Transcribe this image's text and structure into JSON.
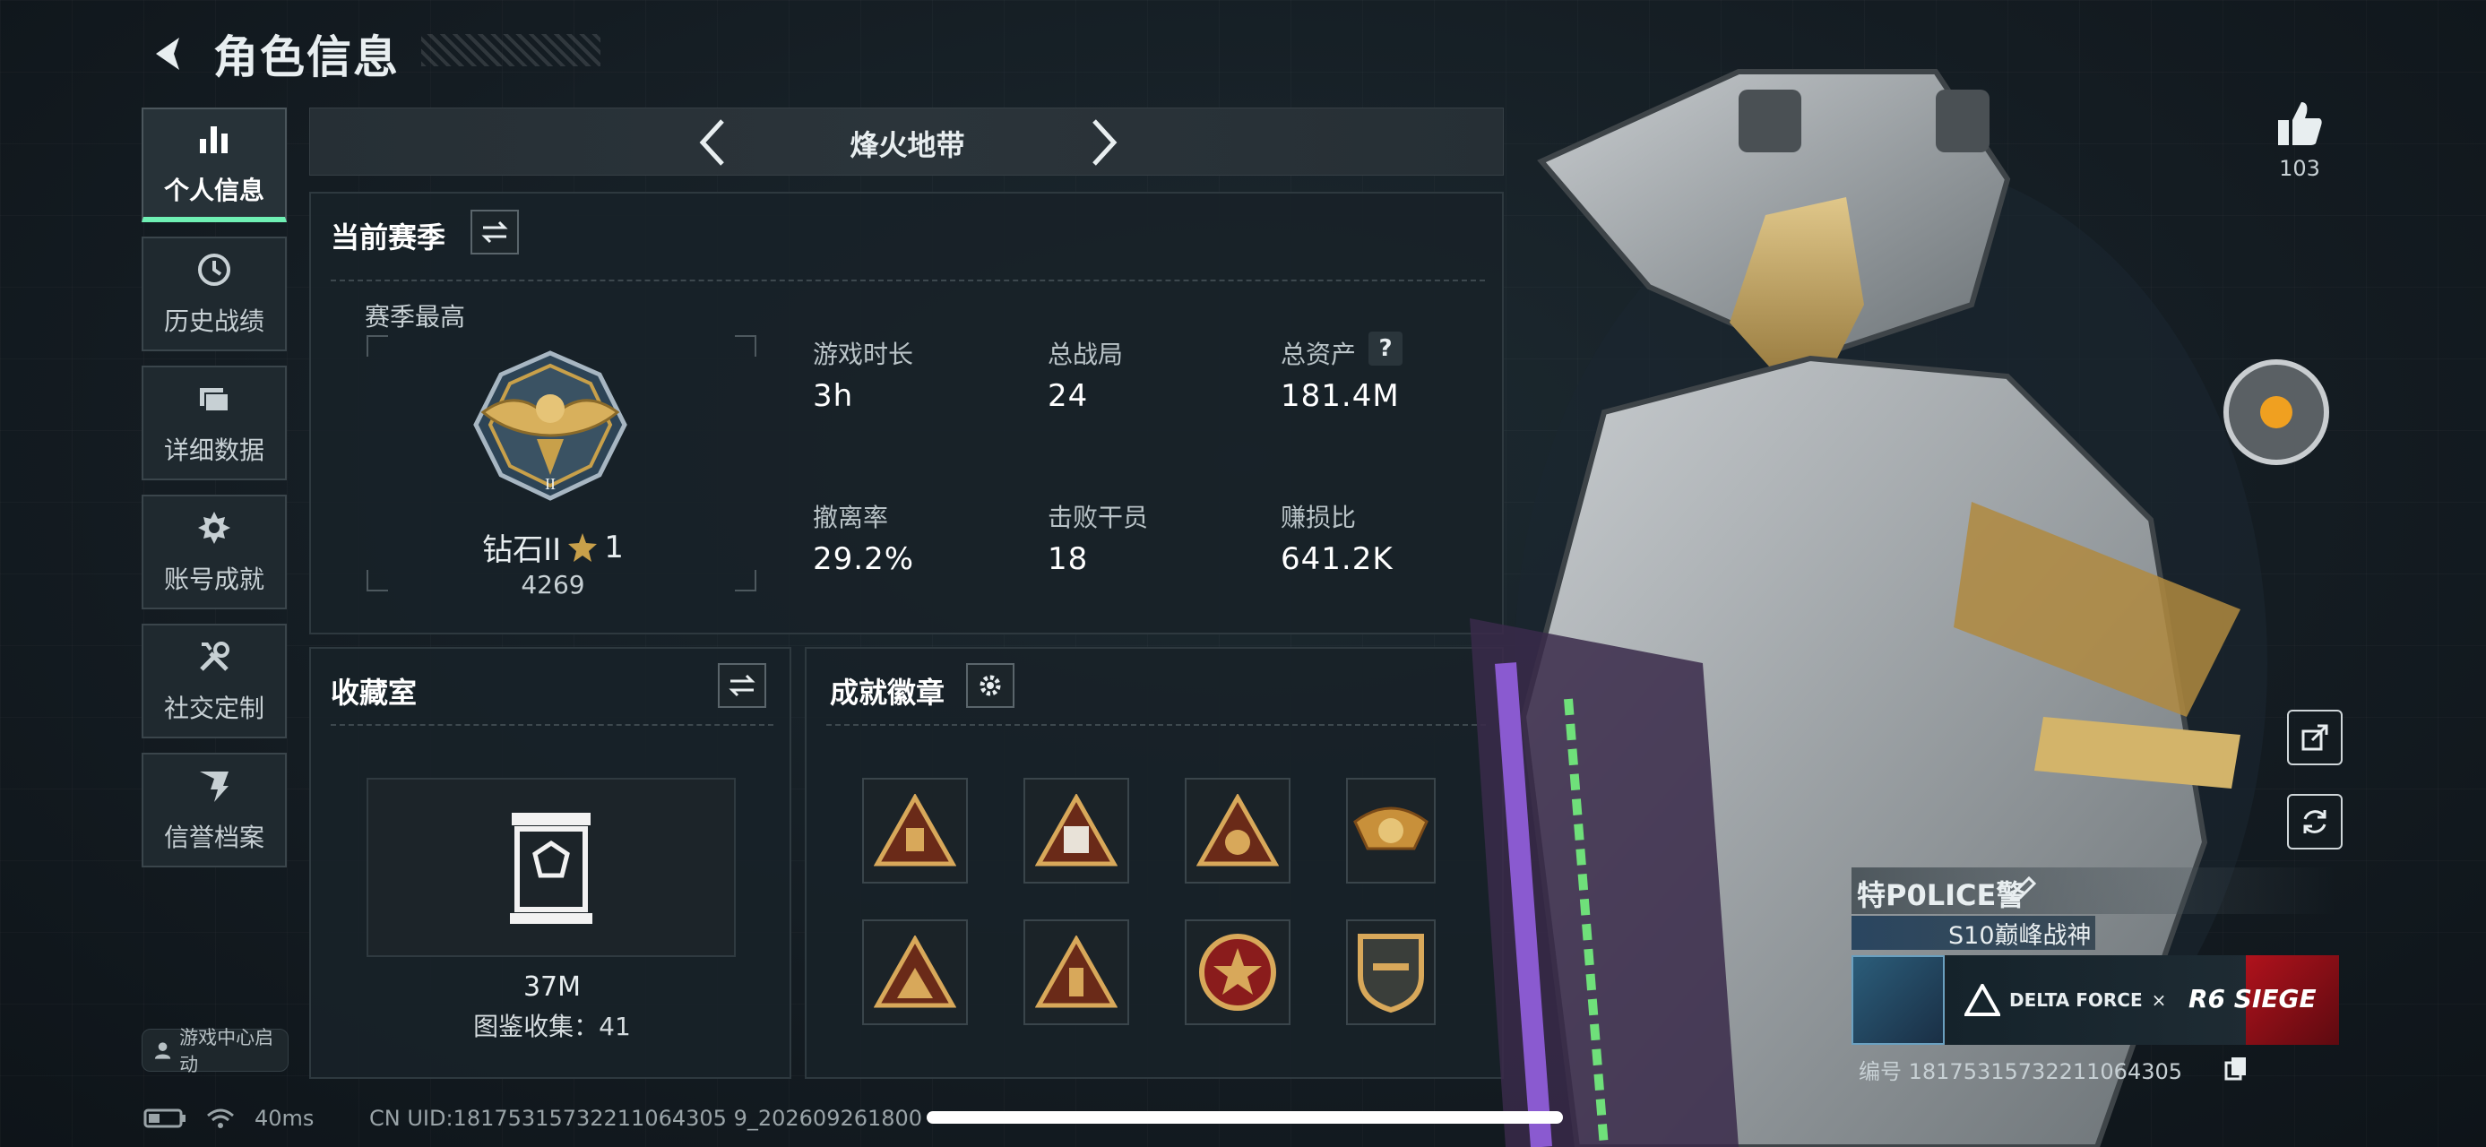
{
  "header": {
    "title": "角色信息"
  },
  "sidebar": {
    "items": [
      {
        "label": "个人信息",
        "icon": "bar-chart-icon"
      },
      {
        "label": "历史战绩",
        "icon": "clock-icon"
      },
      {
        "label": "详细数据",
        "icon": "folder-icon"
      },
      {
        "label": "账号成就",
        "icon": "achievement-icon"
      },
      {
        "label": "社交定制",
        "icon": "tools-icon"
      },
      {
        "label": "信誉档案",
        "icon": "shield-icon"
      }
    ],
    "launch_label": "游戏中心启动"
  },
  "mode": {
    "name": "烽火地带"
  },
  "season": {
    "title": "当前赛季",
    "best_label": "赛季最高",
    "rank_name": "钻石II",
    "rank_stars": "1",
    "rank_score": "4269",
    "stats": [
      {
        "label": "游戏时长",
        "value": "3h"
      },
      {
        "label": "总战局",
        "value": "24"
      },
      {
        "label": "总资产",
        "value": "181.4M"
      },
      {
        "label": "撤离率",
        "value": "29.2%"
      },
      {
        "label": "击败干员",
        "value": "18"
      },
      {
        "label": "赚损比",
        "value": "641.2K"
      }
    ]
  },
  "collection": {
    "title": "收藏室",
    "value": "37M",
    "catalog": "图鉴收集：41"
  },
  "achievements": {
    "title": "成就徽章",
    "badge_count": 8
  },
  "player": {
    "likes": "103",
    "name": "特P0LICE警",
    "title": "S10巅峰战神",
    "banner_text_left": "DELTA FORCE",
    "banner_text_x": "×",
    "banner_text_right": "R6 SIEGE",
    "id_line": "编号 18175315732211064305"
  },
  "status_bar": {
    "ping": "40ms",
    "uid": "CN UID:18175315732211064305 9_202609261800"
  },
  "colors": {
    "accent": "#6ff0b4",
    "background": "#141c22",
    "gold": "#c8a04a"
  }
}
